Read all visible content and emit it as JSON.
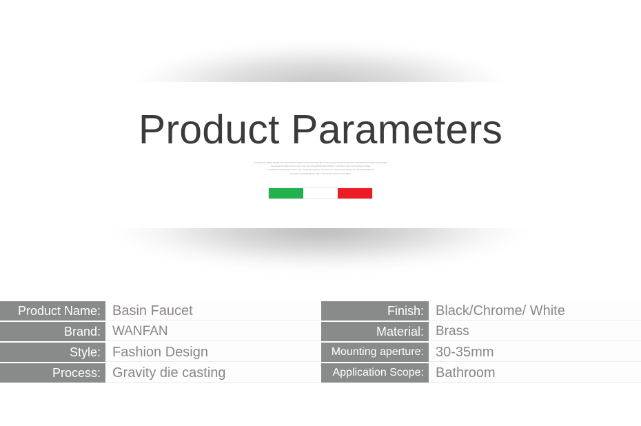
{
  "hero": {
    "title": "Product Parameters",
    "microtext_lines": [
      "ILLEGIBLE BLURRED MARKETING DESCRIPTION MICRO TEXT LINE ONE ABOUT THE FAUCET PRODUCT QUALITY AND MANUFACTURING STANDARDS",
      "ILLEGIBLE BLURRED MICRO TEXT LINE TWO DESCRIBING BRASS BODY CONSTRUCTION AND SURFACE FINISH",
      "ILLEGIBLE BLURRED MICRO TEXT LINE THREE REGARDING TECHNOLOGY DESIGN AND WATER SAVING PERFORMANCE",
      "ILLEGIBLE BLURRED MICRO TEXT LINE FOUR CLOSING STATEMENT"
    ],
    "flag": {
      "name": "italy-flag",
      "stripes": [
        {
          "name": "green-stripe",
          "color": "#22b14c"
        },
        {
          "name": "white-stripe",
          "color": "#ffffff"
        },
        {
          "name": "red-stripe",
          "color": "#ed1c24"
        }
      ]
    }
  },
  "spec_table": {
    "rows": [
      {
        "left_label": "Product Name:",
        "left_value": "Basin Faucet",
        "right_label": "Finish:",
        "right_value": "Black/Chrome/ White"
      },
      {
        "left_label": "Brand:",
        "left_value": "WANFAN",
        "right_label": "Material:",
        "right_value": "Brass"
      },
      {
        "left_label": "Style:",
        "left_value": "Fashion Design",
        "right_label": "Mounting aperture:",
        "right_value": "30-35mm"
      },
      {
        "left_label": "Process:",
        "left_value": "Gravity die casting",
        "right_label": "Application Scope:",
        "right_value": "Bathroom"
      }
    ]
  },
  "colors": {
    "label_gray": "#898b8b",
    "value_text": "#8d8585",
    "title_text": "#3b3b3b",
    "page_background": "#ffffff"
  }
}
